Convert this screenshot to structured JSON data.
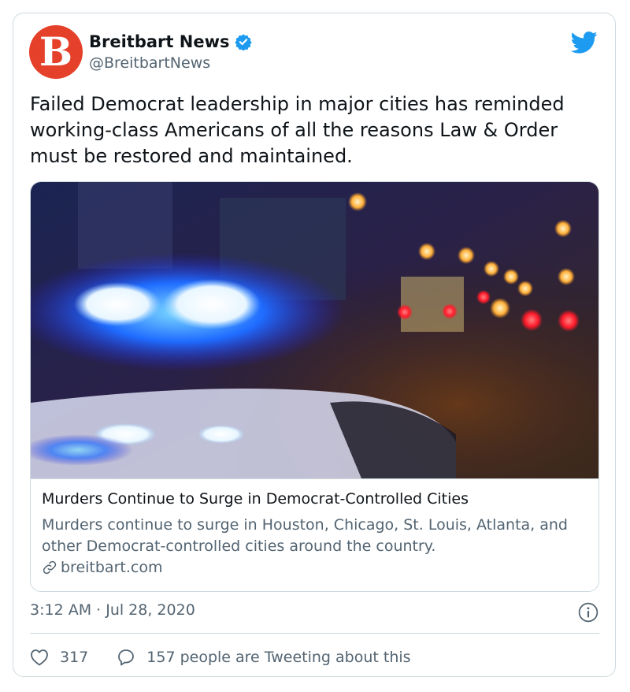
{
  "tweet": {
    "avatar_letter": "B",
    "author_name": "Breitbart News",
    "author_handle": "@BreitbartNews",
    "verified": true,
    "text": "Failed Democrat leadership in major cities has reminded working-class Americans of all the reasons Law & Order must be restored and maintained.",
    "timestamp": "3:12 AM · Jul 28, 2020"
  },
  "link_card": {
    "image_icon": "blurred-police-lights-photo",
    "title": "Murders Continue to Surge in Democrat-Controlled Cities",
    "description": "Murders continue to surge in Houston, Chicago, St. Louis, Atlanta, and other Democrat-controlled cities around the country.",
    "domain": "breitbart.com"
  },
  "actions": {
    "like_count": "317",
    "reply_text": "157 people are Tweeting about this"
  },
  "colors": {
    "brand_red": "#e4402a",
    "twitter_blue": "#1d9bf0",
    "text_primary": "#0f1419",
    "text_secondary": "#536471",
    "border": "#cfd9de"
  }
}
